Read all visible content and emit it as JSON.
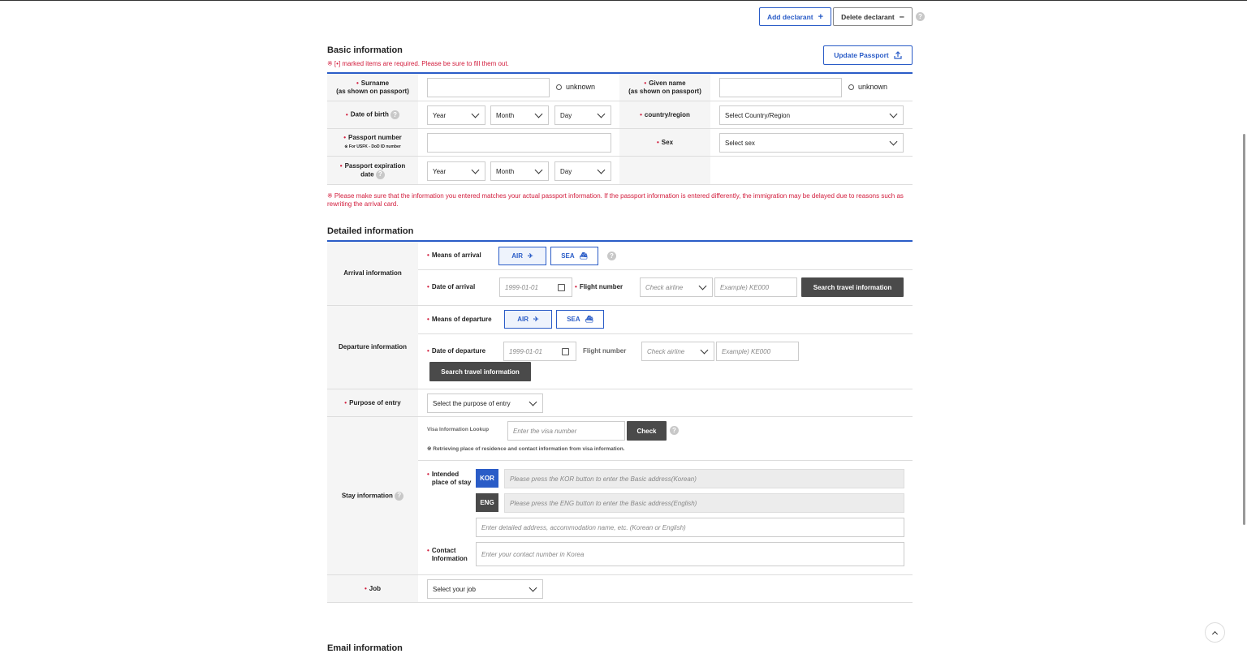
{
  "header": {
    "add_declarant": "Add declarant",
    "delete_declarant": "Delete declarant"
  },
  "basic": {
    "title": "Basic information",
    "required_note": "※ [•] marked items are required. Please be sure to fill them out.",
    "update_passport": "Update Passport",
    "surname_label_1": "Surname",
    "surname_label_2": "(as shown on passport)",
    "given_label_1": "Given name",
    "given_label_2": "(as shown on passport)",
    "unknown": "unknown",
    "dob_label": "Date of birth",
    "year": "Year",
    "month": "Month",
    "day": "Day",
    "country_label": "country/region",
    "country_placeholder": "Select Country/Region",
    "passport_label": "Passport number",
    "passport_sub": "※ For USFK - DoD ID number",
    "sex_label": "Sex",
    "sex_placeholder": "Select sex",
    "expiry_label_1": "Passport expiration",
    "expiry_label_2": "date",
    "warning": "※ Please make sure that the information you entered matches your actual passport information. If the passport information is entered differently, the immigration may be delayed due to reasons such as rewriting the arrival card."
  },
  "detailed": {
    "title": "Detailed information",
    "arrival_info": "Arrival information",
    "means_arrival": "Means of arrival",
    "air": "AIR",
    "sea": "SEA",
    "date_arrival": "Date of arrival",
    "date_placeholder": "1999-01-01",
    "flight_number": "Flight number",
    "check_airline": "Check airline",
    "flight_placeholder": "Example) KE000",
    "search_travel": "Search travel information",
    "departure_info": "Departure information",
    "means_departure": "Means of departure",
    "date_departure": "Date of departure",
    "purpose_label": "Purpose of entry",
    "purpose_placeholder": "Select the purpose of entry",
    "stay_info": "Stay information",
    "visa_lookup": "Visa Information Lookup",
    "visa_placeholder": "Enter the visa number",
    "check": "Check",
    "visa_note": "※ Retrieving place of residence and contact information from visa information.",
    "intended_1": "Intended",
    "intended_2": "place of stay",
    "kor": "KOR",
    "eng": "ENG",
    "kor_placeholder": "Please press the KOR button to enter the Basic address(Korean)",
    "eng_placeholder": "Please press the ENG button to enter the Basic address(English)",
    "detail_placeholder": "Enter detailed address, accommodation name, etc. (Korean or English)",
    "contact_1": "Contact",
    "contact_2": "Information",
    "contact_placeholder": "Enter your contact number in Korea",
    "job_label": "Job",
    "job_placeholder": "Select your job"
  },
  "email": {
    "title": "Email information"
  },
  "colors": {
    "accent": "#2a5cc7",
    "required": "#d21c3c",
    "dark_button": "#4a4a4a"
  },
  "icons": [
    "plus-icon",
    "minus-icon",
    "help-icon",
    "upload-icon",
    "plane-icon",
    "ship-icon",
    "calendar-icon",
    "chevron-down-icon",
    "arrow-up-icon"
  ]
}
